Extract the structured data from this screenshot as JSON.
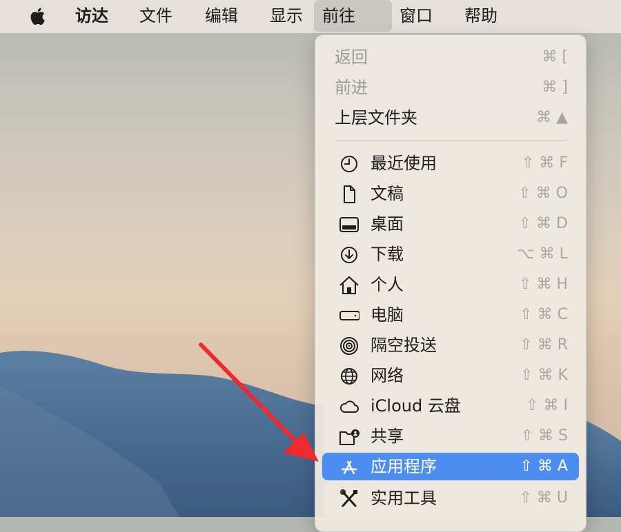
{
  "menubar": {
    "items": [
      {
        "label": "访达"
      },
      {
        "label": "文件"
      },
      {
        "label": "编辑"
      },
      {
        "label": "显示"
      },
      {
        "label": "前往"
      },
      {
        "label": "窗口"
      },
      {
        "label": "帮助"
      }
    ]
  },
  "go_menu": {
    "items": [
      {
        "label": "返回",
        "shortcut": "⌘ [",
        "enabled": false
      },
      {
        "label": "前进",
        "shortcut": "⌘ ]",
        "enabled": false
      },
      {
        "label": "上层文件夹",
        "shortcut": "⌘ ▲",
        "enabled": true
      },
      {
        "label": "最近使用",
        "shortcut": "⇧ ⌘ F",
        "icon": "clock-icon"
      },
      {
        "label": "文稿",
        "shortcut": "⇧ ⌘ O",
        "icon": "document-icon"
      },
      {
        "label": "桌面",
        "shortcut": "⇧ ⌘ D",
        "icon": "desktop-icon"
      },
      {
        "label": "下载",
        "shortcut": "⌥ ⌘ L",
        "icon": "download-icon"
      },
      {
        "label": "个人",
        "shortcut": "⇧ ⌘ H",
        "icon": "home-icon"
      },
      {
        "label": "电脑",
        "shortcut": "⇧ ⌘ C",
        "icon": "computer-icon"
      },
      {
        "label": "隔空投送",
        "shortcut": "⇧ ⌘ R",
        "icon": "airdrop-icon"
      },
      {
        "label": "网络",
        "shortcut": "⇧ ⌘ K",
        "icon": "globe-icon"
      },
      {
        "label": "iCloud 云盘",
        "shortcut": "⇧ ⌘ I",
        "icon": "cloud-icon"
      },
      {
        "label": "共享",
        "shortcut": "⇧ ⌘ S",
        "icon": "shared-folder-icon"
      },
      {
        "label": "应用程序",
        "shortcut": "⇧ ⌘ A",
        "icon": "app-store-icon",
        "selected": true
      },
      {
        "label": "实用工具",
        "shortcut": "⇧ ⌘ U",
        "icon": "tools-icon"
      }
    ]
  },
  "colors": {
    "highlight": "#4e8df0",
    "annotation_arrow": "#ee2a2f"
  }
}
